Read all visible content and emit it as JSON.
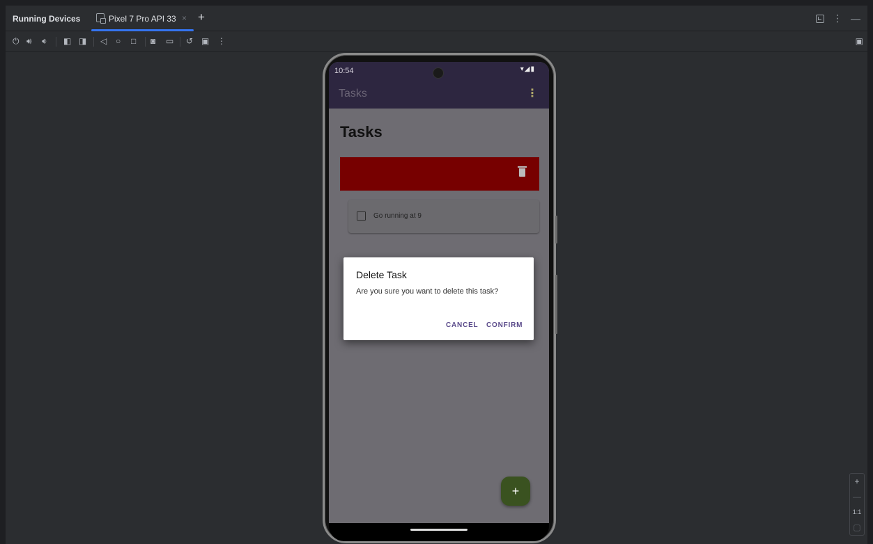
{
  "window": {
    "title": "Running Devices",
    "device_tab": "Pixel 7 Pro API 33",
    "close_tab": "×",
    "add_tab": "+"
  },
  "toolbar_icons": [
    "power-icon",
    "volume-up-icon",
    "volume-down-icon",
    "rotate-left-icon",
    "rotate-right-icon",
    "back-icon",
    "home-icon",
    "overview-icon",
    "screenshot-icon",
    "screen-record-icon",
    "undo-icon",
    "snapshot-icon",
    "more-icon"
  ],
  "status_bar": {
    "time": "10:54",
    "icons": "▾◢▮"
  },
  "app_bar": {
    "title": "Tasks",
    "menu": "⋮"
  },
  "content": {
    "heading": "Tasks",
    "task_text": "Go running at 9"
  },
  "dialog": {
    "title": "Delete Task",
    "message": "Are you sure you want to delete this task?",
    "cancel": "CANCEL",
    "confirm": "CONFIRM"
  },
  "fab": {
    "label": "+"
  },
  "zoom": {
    "in": "+",
    "out": "—",
    "actual": "1:1"
  },
  "colors": {
    "accent": "#3574f0",
    "app_bar": "#2d2640",
    "swipe_delete": "#770000",
    "fab": "#3a5220",
    "dialog_button": "#5a4a8a"
  }
}
